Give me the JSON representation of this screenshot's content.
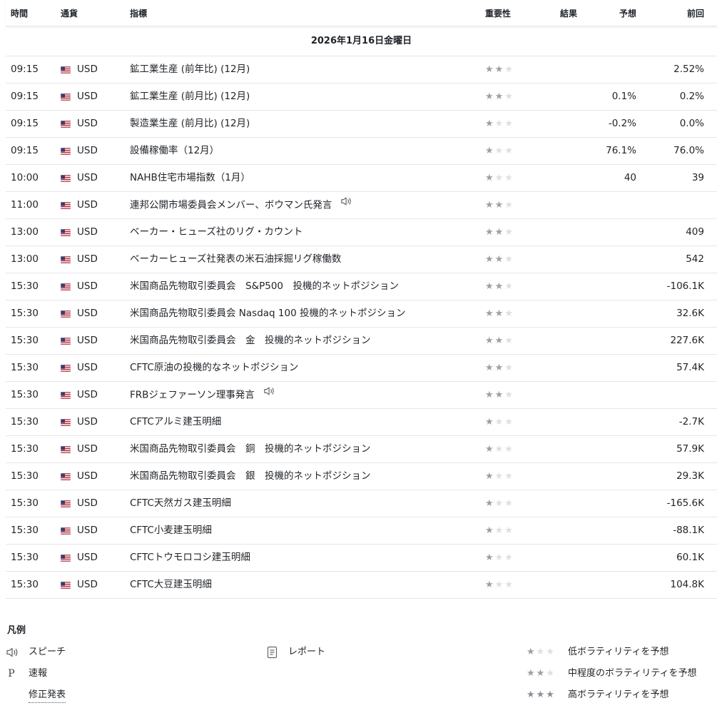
{
  "header": {
    "time": "時間",
    "currency": "通貨",
    "indicator": "指標",
    "importance": "重要性",
    "actual": "結果",
    "forecast": "予想",
    "previous": "前回"
  },
  "date_label": "2026年1月16日金曜日",
  "rows": [
    {
      "time": "09:15",
      "currency": "USD",
      "indicator": "鉱工業生産 (前年比) (12月)",
      "importance": 2,
      "forecast": "",
      "previous": "2.52%",
      "speech": false
    },
    {
      "time": "09:15",
      "currency": "USD",
      "indicator": "鉱工業生産 (前月比) (12月)",
      "importance": 2,
      "forecast": "0.1%",
      "previous": "0.2%",
      "speech": false
    },
    {
      "time": "09:15",
      "currency": "USD",
      "indicator": "製造業生産 (前月比) (12月)",
      "importance": 1,
      "forecast": "-0.2%",
      "previous": "0.0%",
      "speech": false
    },
    {
      "time": "09:15",
      "currency": "USD",
      "indicator": "設備稼働率（12月）",
      "importance": 1,
      "forecast": "76.1%",
      "previous": "76.0%",
      "speech": false
    },
    {
      "time": "10:00",
      "currency": "USD",
      "indicator": "NAHB住宅市場指数（1月）",
      "importance": 1,
      "forecast": "40",
      "previous": "39",
      "speech": false
    },
    {
      "time": "11:00",
      "currency": "USD",
      "indicator": "連邦公開市場委員会メンバー、ボウマン氏発言",
      "importance": 2,
      "forecast": "",
      "previous": "",
      "speech": true
    },
    {
      "time": "13:00",
      "currency": "USD",
      "indicator": "ベーカー・ヒューズ社のリグ・カウント",
      "importance": 2,
      "forecast": "",
      "previous": "409",
      "speech": false
    },
    {
      "time": "13:00",
      "currency": "USD",
      "indicator": "ベーカーヒューズ社発表の米石油採掘リグ稼働数",
      "importance": 2,
      "forecast": "",
      "previous": "542",
      "speech": false
    },
    {
      "time": "15:30",
      "currency": "USD",
      "indicator": "米国商品先物取引委員会　S&P500　投機的ネットポジション",
      "importance": 2,
      "forecast": "",
      "previous": "-106.1K",
      "speech": false
    },
    {
      "time": "15:30",
      "currency": "USD",
      "indicator": "米国商品先物取引委員会 Nasdaq 100 投機的ネットポジション",
      "importance": 2,
      "forecast": "",
      "previous": "32.6K",
      "speech": false
    },
    {
      "time": "15:30",
      "currency": "USD",
      "indicator": "米国商品先物取引委員会　金　投機的ネットポジション",
      "importance": 2,
      "forecast": "",
      "previous": "227.6K",
      "speech": false
    },
    {
      "time": "15:30",
      "currency": "USD",
      "indicator": "CFTC原油の投機的なネットポジション",
      "importance": 2,
      "forecast": "",
      "previous": "57.4K",
      "speech": false
    },
    {
      "time": "15:30",
      "currency": "USD",
      "indicator": "FRBジェファーソン理事発言",
      "importance": 2,
      "forecast": "",
      "previous": "",
      "speech": true
    },
    {
      "time": "15:30",
      "currency": "USD",
      "indicator": "CFTCアルミ建玉明細",
      "importance": 1,
      "forecast": "",
      "previous": "-2.7K",
      "speech": false
    },
    {
      "time": "15:30",
      "currency": "USD",
      "indicator": "米国商品先物取引委員会　銅　投機的ネットポジション",
      "importance": 1,
      "forecast": "",
      "previous": "57.9K",
      "speech": false
    },
    {
      "time": "15:30",
      "currency": "USD",
      "indicator": "米国商品先物取引委員会　銀　投機的ネットポジション",
      "importance": 1,
      "forecast": "",
      "previous": "29.3K",
      "speech": false
    },
    {
      "time": "15:30",
      "currency": "USD",
      "indicator": "CFTC天然ガス建玉明細",
      "importance": 1,
      "forecast": "",
      "previous": "-165.6K",
      "speech": false
    },
    {
      "time": "15:30",
      "currency": "USD",
      "indicator": "CFTC小麦建玉明細",
      "importance": 1,
      "forecast": "",
      "previous": "-88.1K",
      "speech": false
    },
    {
      "time": "15:30",
      "currency": "USD",
      "indicator": "CFTCトウモロコシ建玉明細",
      "importance": 1,
      "forecast": "",
      "previous": "60.1K",
      "speech": false
    },
    {
      "time": "15:30",
      "currency": "USD",
      "indicator": "CFTC大豆建玉明細",
      "importance": 1,
      "forecast": "",
      "previous": "104.8K",
      "speech": false
    }
  ],
  "legend": {
    "title": "凡例",
    "speech": "スピーチ",
    "flash_icon": "P",
    "flash": "速報",
    "revised": "修正発表",
    "report": "レポート",
    "low": "低ボラティリティを予想",
    "mid": "中程度のボラティリティを予想",
    "high": "高ボラティリティを予想"
  },
  "colors": {
    "star_on": "#9aa0a6",
    "star_off": "#dcdfe3",
    "star_legend_high": "#8a9097",
    "border": "#e6e6e6"
  },
  "icons": {
    "flag": "us-flag-icon",
    "speech": "speaker-icon",
    "report": "document-icon",
    "star": "star-icon"
  }
}
